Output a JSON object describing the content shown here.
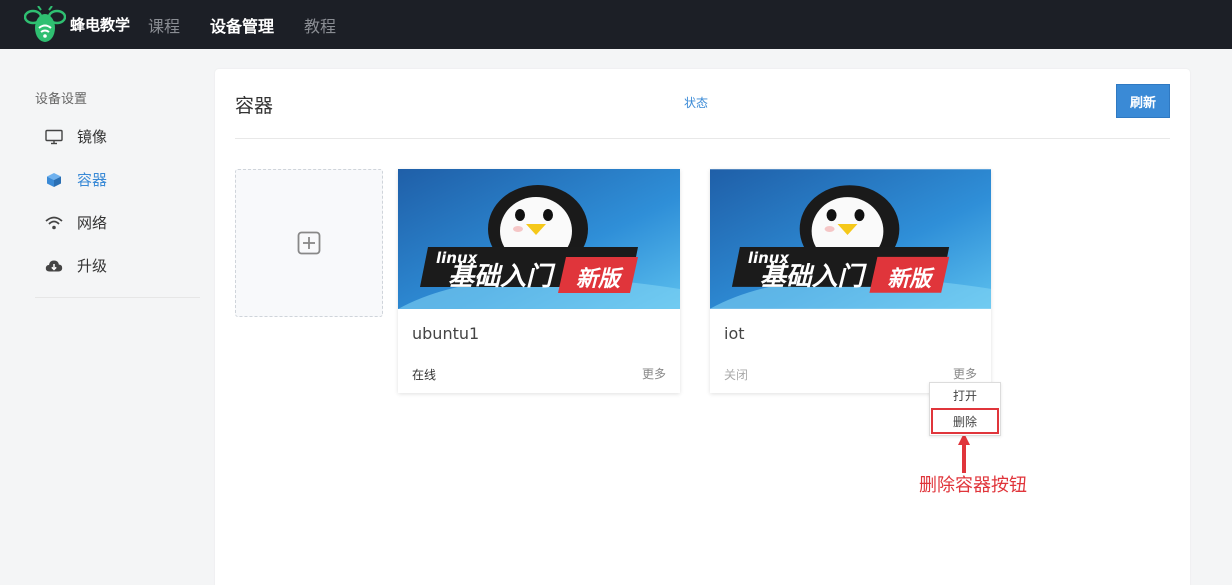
{
  "brand": {
    "name": "蜂电教学",
    "accent": "#2fbf71"
  },
  "nav": [
    {
      "label": "课程",
      "active": false
    },
    {
      "label": "设备管理",
      "active": true
    },
    {
      "label": "教程",
      "active": false
    }
  ],
  "sidebar": {
    "section": "设备设置",
    "items": [
      {
        "label": "镜像",
        "icon": "monitor-icon",
        "active": false
      },
      {
        "label": "容器",
        "icon": "cube-icon",
        "active": true
      },
      {
        "label": "网络",
        "icon": "wifi-icon",
        "active": false
      },
      {
        "label": "升级",
        "icon": "cloud-download-icon",
        "active": false
      }
    ]
  },
  "panel": {
    "title": "容器",
    "status_link": "状态",
    "refresh_label": "刷新",
    "add_icon": "plus-square-icon"
  },
  "containers": [
    {
      "name": "ubuntu1",
      "status": "在线",
      "more": "更多",
      "thumbnail": {
        "tag": "linux",
        "title": "基础入门",
        "badge": "新版"
      }
    },
    {
      "name": "iot",
      "status": "关闭",
      "more": "更多",
      "thumbnail": {
        "tag": "linux",
        "title": "基础入门",
        "badge": "新版"
      }
    }
  ],
  "dropdown": {
    "open_label": "打开",
    "delete_label": "删除"
  },
  "annotation": {
    "text": "删除容器按钮",
    "color": "#e0353b"
  },
  "colors": {
    "topbar": "#1c1f26",
    "primary": "#3a8ad6"
  }
}
